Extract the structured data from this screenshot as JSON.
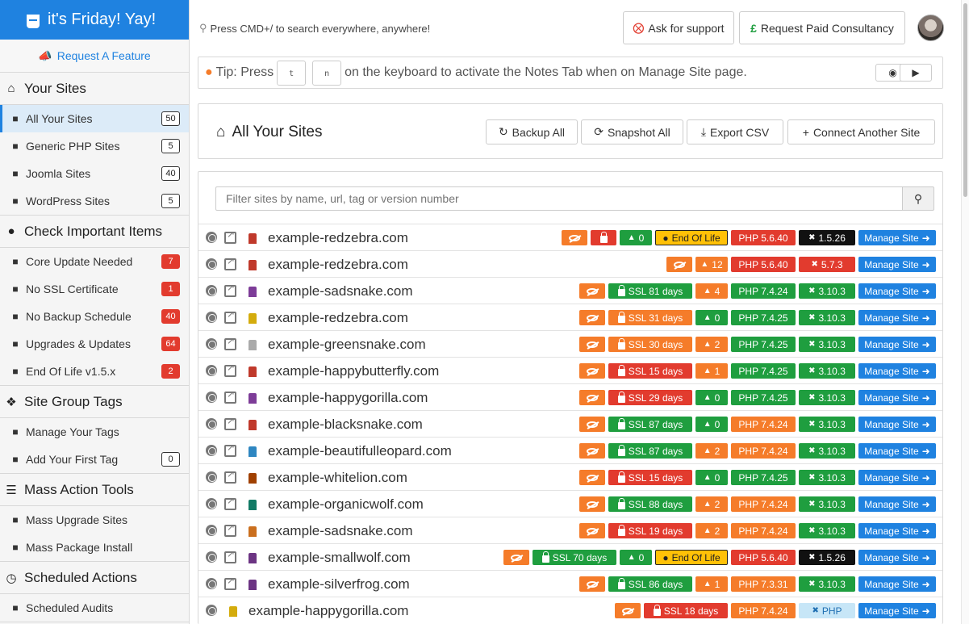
{
  "brand": {
    "title": "it's Friday! Yay!"
  },
  "sidebar": {
    "request_feature": "Request A Feature",
    "sections": [
      {
        "title": "Your Sites",
        "items": [
          {
            "label": "All Your Sites",
            "count": "50",
            "icon": "globe-icon"
          },
          {
            "label": "Generic PHP Sites",
            "count": "5",
            "icon": "php-icon"
          },
          {
            "label": "Joomla Sites",
            "count": "40",
            "icon": "joomla-icon"
          },
          {
            "label": "WordPress Sites",
            "count": "5",
            "icon": "wordpress-icon"
          }
        ]
      },
      {
        "title": "Check Important Items",
        "items": [
          {
            "label": "Core Update Needed",
            "count": "7",
            "icon": "cloud-upload-icon"
          },
          {
            "label": "No SSL Certificate",
            "count": "1",
            "icon": "unlock-icon"
          },
          {
            "label": "No Backup Schedule",
            "count": "40",
            "icon": "clock-icon"
          },
          {
            "label": "Upgrades & Updates",
            "count": "64",
            "icon": "cloud-icon"
          },
          {
            "label": "End Of Life v1.5.x",
            "count": "2",
            "icon": "joomla-icon"
          }
        ]
      },
      {
        "title": "Site Group Tags",
        "items": [
          {
            "label": "Manage Your Tags",
            "count": "",
            "icon": "tags-icon"
          },
          {
            "label": "Add Your First Tag",
            "count": "0",
            "icon": "tag-icon"
          }
        ]
      },
      {
        "title": "Mass Action Tools",
        "items": [
          {
            "label": "Mass Upgrade Sites",
            "count": "",
            "icon": "upgrade-icon"
          },
          {
            "label": "Mass Package Install",
            "count": "",
            "icon": "package-icon"
          }
        ]
      },
      {
        "title": "Scheduled Actions",
        "items": [
          {
            "label": "Scheduled Audits",
            "count": "",
            "icon": "check-circle-icon"
          }
        ]
      }
    ]
  },
  "topbar": {
    "search_hint": "Press CMD+/ to search everywhere, anywhere!",
    "support_label": "Ask for support",
    "paid_label": "Request Paid Consultancy"
  },
  "tip": {
    "prefix": "Tip: Press",
    "key1": "t",
    "key2": "n",
    "suffix": "on the keyboard to activate the Notes Tab when on Manage Site page."
  },
  "panel": {
    "title": "All Your Sites",
    "backup_label": "Backup All",
    "snapshot_label": "Snapshot All",
    "export_label": "Export CSV",
    "connect_label": "Connect Another Site"
  },
  "filter": {
    "placeholder": "Filter sites by name, url, tag or version number"
  },
  "manage_label": "Manage Site",
  "sites": [
    {
      "domain": "example-redzebra.com",
      "fav": "#c0392b",
      "badges": [
        [
          "orange",
          "eye",
          ""
        ],
        [
          "red",
          "lock",
          ""
        ],
        [
          "green",
          "upd",
          "0"
        ],
        [
          "yellow",
          "eol",
          "End Of Life"
        ],
        [
          "red",
          "php",
          "PHP 5.6.40"
        ],
        [
          "black",
          "ver",
          "1.5.26"
        ]
      ]
    },
    {
      "domain": "example-redzebra.com",
      "fav": "#c0392b",
      "badges": [
        [
          "orange",
          "eye",
          ""
        ],
        [
          "orange",
          "upd",
          "12"
        ],
        [
          "red",
          "php",
          "PHP 5.6.40"
        ],
        [
          "red",
          "ver",
          "5.7.3"
        ]
      ]
    },
    {
      "domain": "example-sadsnake.com",
      "fav": "#7d3c98",
      "badges": [
        [
          "orange",
          "eye",
          ""
        ],
        [
          "green",
          "ssl",
          "SSL 81 days"
        ],
        [
          "orange",
          "upd",
          "4"
        ],
        [
          "green",
          "php",
          "PHP 7.4.24"
        ],
        [
          "green",
          "ver",
          "3.10.3"
        ]
      ]
    },
    {
      "domain": "example-redzebra.com",
      "fav": "#d4ac0d",
      "badges": [
        [
          "orange",
          "eye",
          ""
        ],
        [
          "orange",
          "ssl",
          "SSL 31 days"
        ],
        [
          "green",
          "upd",
          "0"
        ],
        [
          "green",
          "php",
          "PHP 7.4.25"
        ],
        [
          "green",
          "ver",
          "3.10.3"
        ]
      ]
    },
    {
      "domain": "example-greensnake.com",
      "fav": "#aaaaaa",
      "badges": [
        [
          "orange",
          "eye",
          ""
        ],
        [
          "orange",
          "ssl",
          "SSL 30 days"
        ],
        [
          "orange",
          "upd",
          "2"
        ],
        [
          "green",
          "php",
          "PHP 7.4.25"
        ],
        [
          "green",
          "ver",
          "3.10.3"
        ]
      ]
    },
    {
      "domain": "example-happybutterfly.com",
      "fav": "#c0392b",
      "badges": [
        [
          "orange",
          "eye",
          ""
        ],
        [
          "red",
          "ssl",
          "SSL 15 days"
        ],
        [
          "orange",
          "upd",
          "1"
        ],
        [
          "green",
          "php",
          "PHP 7.4.25"
        ],
        [
          "green",
          "ver",
          "3.10.3"
        ]
      ]
    },
    {
      "domain": "example-happygorilla.com",
      "fav": "#7d3c98",
      "badges": [
        [
          "orange",
          "eye",
          ""
        ],
        [
          "red",
          "ssl",
          "SSL 29 days"
        ],
        [
          "green",
          "upd",
          "0"
        ],
        [
          "green",
          "php",
          "PHP 7.4.25"
        ],
        [
          "green",
          "ver",
          "3.10.3"
        ]
      ]
    },
    {
      "domain": "example-blacksnake.com",
      "fav": "#c0392b",
      "badges": [
        [
          "orange",
          "eye",
          ""
        ],
        [
          "green",
          "ssl",
          "SSL 87 days"
        ],
        [
          "green",
          "upd",
          "0"
        ],
        [
          "orange",
          "php",
          "PHP 7.4.24"
        ],
        [
          "green",
          "ver",
          "3.10.3"
        ]
      ]
    },
    {
      "domain": "example-beautifulleopard.com",
      "fav": "#2e86c1",
      "badges": [
        [
          "orange",
          "eye",
          ""
        ],
        [
          "green",
          "ssl",
          "SSL 87 days"
        ],
        [
          "orange",
          "upd",
          "2"
        ],
        [
          "orange",
          "php",
          "PHP 7.4.24"
        ],
        [
          "green",
          "ver",
          "3.10.3"
        ]
      ]
    },
    {
      "domain": "example-whitelion.com",
      "fav": "#a04000",
      "badges": [
        [
          "orange",
          "eye",
          ""
        ],
        [
          "red",
          "ssl",
          "SSL 15 days"
        ],
        [
          "green",
          "upd",
          "0"
        ],
        [
          "green",
          "php",
          "PHP 7.4.25"
        ],
        [
          "green",
          "ver",
          "3.10.3"
        ]
      ]
    },
    {
      "domain": "example-organicwolf.com",
      "fav": "#117a65",
      "badges": [
        [
          "orange",
          "eye",
          ""
        ],
        [
          "green",
          "ssl",
          "SSL 88 days"
        ],
        [
          "orange",
          "upd",
          "2"
        ],
        [
          "orange",
          "php",
          "PHP 7.4.24"
        ],
        [
          "green",
          "ver",
          "3.10.3"
        ]
      ]
    },
    {
      "domain": "example-sadsnake.com",
      "fav": "#ca6f1e",
      "badges": [
        [
          "orange",
          "eye",
          ""
        ],
        [
          "red",
          "ssl",
          "SSL 19 days"
        ],
        [
          "orange",
          "upd",
          "2"
        ],
        [
          "orange",
          "php",
          "PHP 7.4.24"
        ],
        [
          "green",
          "ver",
          "3.10.3"
        ]
      ]
    },
    {
      "domain": "example-smallwolf.com",
      "fav": "#6c3483",
      "badges": [
        [
          "orange",
          "eye",
          ""
        ],
        [
          "green",
          "ssl",
          "SSL 70 days"
        ],
        [
          "green",
          "upd",
          "0"
        ],
        [
          "yellow",
          "eol",
          "End Of Life"
        ],
        [
          "red",
          "php",
          "PHP 5.6.40"
        ],
        [
          "black",
          "ver",
          "1.5.26"
        ]
      ]
    },
    {
      "domain": "example-silverfrog.com",
      "fav": "#6c3483",
      "badges": [
        [
          "orange",
          "eye",
          ""
        ],
        [
          "green",
          "ssl",
          "SSL 86 days"
        ],
        [
          "orange",
          "upd",
          "1"
        ],
        [
          "orange",
          "php",
          "PHP 7.3.31"
        ],
        [
          "green",
          "ver",
          "3.10.3"
        ]
      ]
    },
    {
      "domain": "example-happygorilla.com",
      "fav": "#d4ac0d",
      "nolink": true,
      "badges": [
        [
          "orange",
          "eye",
          ""
        ],
        [
          "red",
          "ssl",
          "SSL 18 days"
        ],
        [
          "orange",
          "php",
          "PHP 7.4.24"
        ],
        [
          "lblue",
          "ver",
          "PHP"
        ]
      ]
    }
  ]
}
